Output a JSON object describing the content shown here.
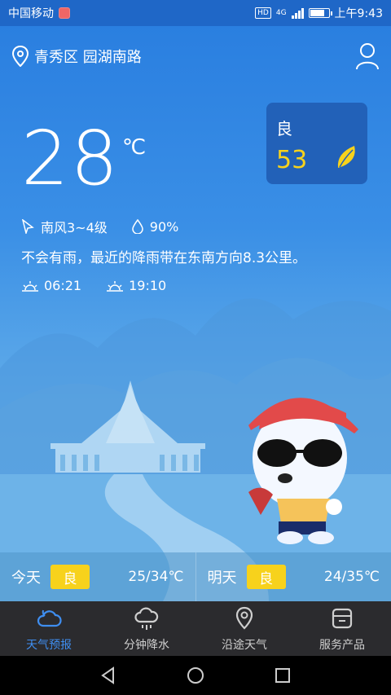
{
  "status": {
    "carrier": "中国移动",
    "hd": "HD",
    "network": "4G",
    "time": "上午9:43",
    "battery_level": 0.8
  },
  "location": {
    "name": "青秀区 园湖南路"
  },
  "weather": {
    "temperature": "28",
    "unit": "℃",
    "wind": "南风3~4级",
    "humidity": "90%",
    "rain_note": "不会有雨，最近的降雨带在东南方向8.3公里。",
    "sunrise": "06:21",
    "sunset": "19:10"
  },
  "aqi": {
    "level": "良",
    "value": "53",
    "accent": "#f7d21c"
  },
  "forecast": [
    {
      "day": "今天",
      "quality": "良",
      "range": "25/34℃"
    },
    {
      "day": "明天",
      "quality": "良",
      "range": "24/35℃"
    }
  ],
  "tabs": [
    {
      "label": "天气预报",
      "icon": "cloud-icon",
      "active": true
    },
    {
      "label": "分钟降水",
      "icon": "rain-cloud-icon",
      "active": false
    },
    {
      "label": "沿途天气",
      "icon": "route-pin-icon",
      "active": false
    },
    {
      "label": "服务产品",
      "icon": "box-icon",
      "active": false
    }
  ],
  "colors": {
    "primary": "#2f7fd8",
    "active_tab": "#3f8ef0",
    "tabbar_bg": "#2b2b2e",
    "badge": "#f7d21c"
  }
}
